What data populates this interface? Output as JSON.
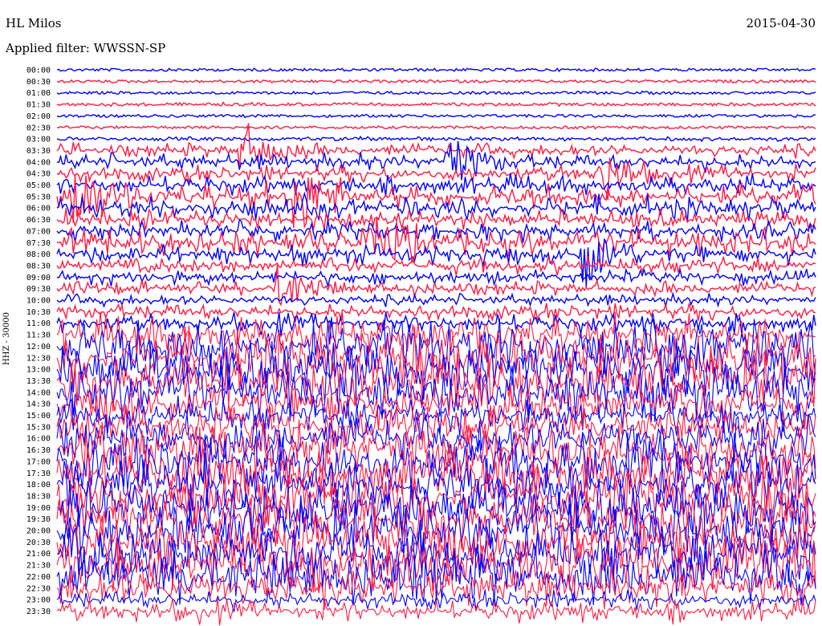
{
  "header": {
    "station": "HL Milos",
    "date": "2015-04-30",
    "filter_label": "Applied filter: WWSSN-SP"
  },
  "chart_data": {
    "type": "line",
    "title": "HL Milos",
    "subtitle": "Applied filter: WWSSN-SP",
    "date": "2015-04-30",
    "ylabel": "HHZ - 30000",
    "row_labels": [
      "00:00",
      "00:30",
      "01:00",
      "01:30",
      "02:00",
      "02:30",
      "03:00",
      "03:30",
      "04:00",
      "04:30",
      "05:00",
      "05:30",
      "06:00",
      "06:30",
      "07:00",
      "07:30",
      "08:00",
      "08:30",
      "09:00",
      "09:30",
      "10:00",
      "10:30",
      "11:00",
      "11:30",
      "12:00",
      "12:30",
      "13:00",
      "13:30",
      "14:00",
      "14:30",
      "15:00",
      "15:30",
      "16:00",
      "16:30",
      "17:00",
      "17:30",
      "18:00",
      "18:30",
      "19:00",
      "19:30",
      "20:00",
      "20:30",
      "21:00",
      "21:30",
      "22:00",
      "22:30",
      "23:00",
      "23:30"
    ],
    "series_colors": [
      "#0000ff",
      "#ff1a40"
    ],
    "trace_activity": [
      0.1,
      0.1,
      0.1,
      0.15,
      0.1,
      0.1,
      0.2,
      0.5,
      0.55,
      0.55,
      0.6,
      0.7,
      0.65,
      0.6,
      0.6,
      0.7,
      0.6,
      0.55,
      0.5,
      0.5,
      0.45,
      0.55,
      0.6,
      0.85,
      1.0,
      1.0,
      1.0,
      1.0,
      1.0,
      0.9,
      0.8,
      0.85,
      0.9,
      1.0,
      1.0,
      1.0,
      1.0,
      1.0,
      1.0,
      1.0,
      1.0,
      1.0,
      1.0,
      1.0,
      1.0,
      0.85,
      0.6,
      0.65
    ],
    "events": [
      {
        "time": "03:30",
        "x_fraction": 0.25,
        "strength": 0.7
      },
      {
        "time": "04:00",
        "x_fraction": 0.52,
        "strength": 0.9
      },
      {
        "time": "04:30",
        "x_fraction": 0.72,
        "strength": 0.8
      },
      {
        "time": "05:30",
        "x_fraction": 0.03,
        "strength": 0.9
      },
      {
        "time": "05:30",
        "x_fraction": 0.32,
        "strength": 1.0
      },
      {
        "time": "07:30",
        "x_fraction": 0.42,
        "strength": 0.9
      },
      {
        "time": "08:00",
        "x_fraction": 0.7,
        "strength": 1.0
      },
      {
        "time": "09:30",
        "x_fraction": 0.3,
        "strength": 0.7
      }
    ],
    "grid": false
  }
}
